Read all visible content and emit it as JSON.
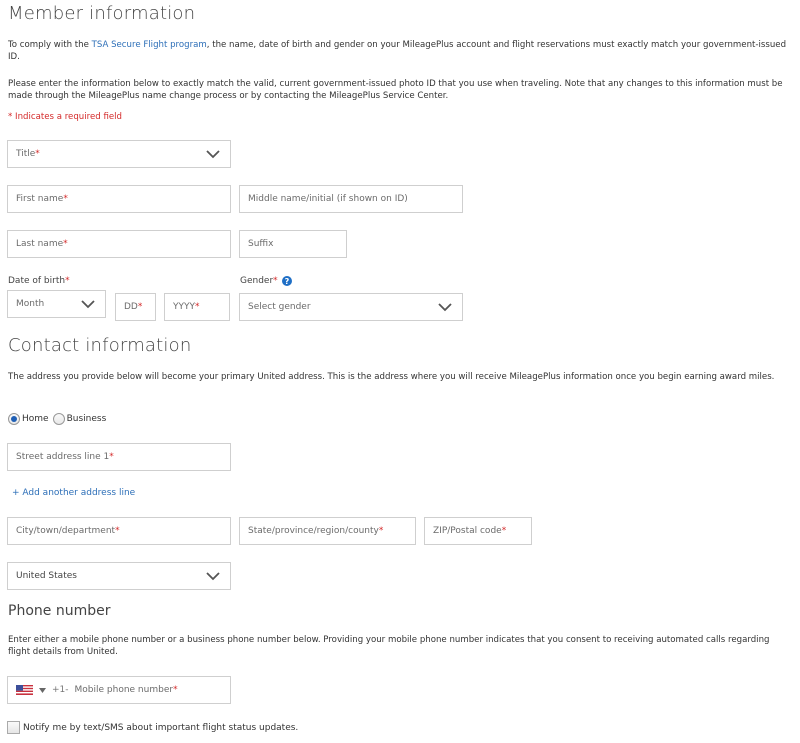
{
  "member": {
    "heading": "Member information",
    "intro_pre": "To comply with the ",
    "intro_link": "TSA Secure Flight program",
    "intro_post": ", the name, date of birth and gender on your MileagePlus account and flight reservations must exactly match your government-issued ID.",
    "instructions": "Please enter the information below to exactly match the valid, current government-issued photo ID that you use when traveling. Note that any changes to this information must be made through the MileagePlus name change process or by contacting the MileagePlus Service Center.",
    "required_note": "* Indicates a required field",
    "title_placeholder": "Title",
    "first_name_placeholder": "First name",
    "middle_name_placeholder": "Middle name/initial (if shown on ID)",
    "last_name_placeholder": "Last name",
    "suffix_placeholder": "Suffix",
    "dob_label": "Date of birth",
    "month_placeholder": "Month",
    "day_placeholder": "DD",
    "year_placeholder": "YYYY",
    "gender_label": "Gender",
    "gender_placeholder": "Select gender",
    "required_mark": "*"
  },
  "contact": {
    "heading": "Contact information",
    "description": "The address you provide below will become your primary United address. This is the address where you will receive MileagePlus information once you begin earning award miles.",
    "address_types": [
      {
        "label": "Home",
        "selected": true
      },
      {
        "label": "Business",
        "selected": false
      }
    ],
    "street_placeholder": "Street address line 1",
    "add_line_link": "+ Add another address line",
    "city_placeholder": "City/town/department",
    "state_placeholder": "State/province/region/county",
    "zip_placeholder": "ZIP/Postal code",
    "country_value": "United States"
  },
  "phone": {
    "heading": "Phone number",
    "description": "Enter either a mobile phone number or a business phone number below. Providing your mobile phone number indicates that you consent to receiving automated calls regarding flight details from United.",
    "country_code": "+1-",
    "placeholder": "Mobile phone number",
    "sms_label": "Notify me by text/SMS about important flight status updates.",
    "sms_checked": false
  }
}
